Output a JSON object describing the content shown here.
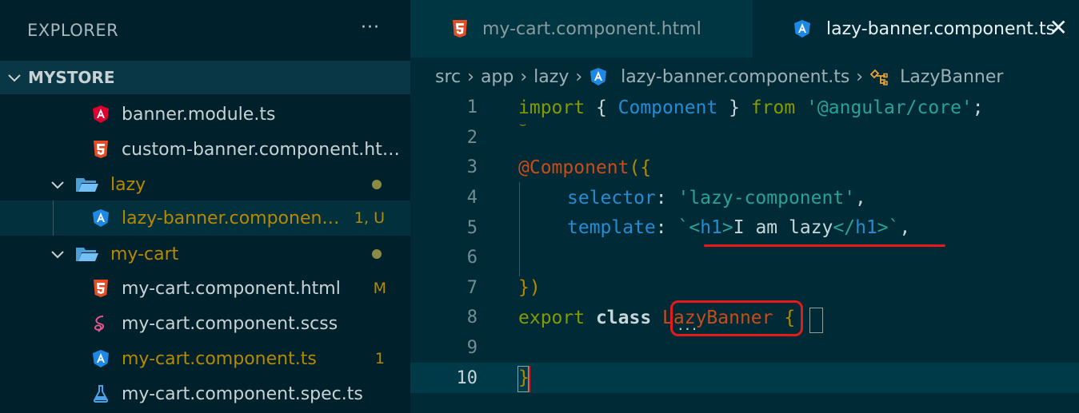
{
  "sidebar": {
    "title": "EXPLORER",
    "more": "···",
    "workspace": "MYSTORE",
    "items": [
      {
        "label": "banner.module.ts",
        "badge": ""
      },
      {
        "label": "custom-banner.component.ht…",
        "badge": ""
      },
      {
        "label": "lazy",
        "badge": ""
      },
      {
        "label": "lazy-banner.componen…",
        "badge": "1, U"
      },
      {
        "label": "my-cart",
        "badge": ""
      },
      {
        "label": "my-cart.component.html",
        "badge": "M"
      },
      {
        "label": "my-cart.component.scss",
        "badge": ""
      },
      {
        "label": "my-cart.component.ts",
        "badge": "1"
      },
      {
        "label": "my-cart.component.spec.ts",
        "badge": ""
      }
    ]
  },
  "tabs": [
    {
      "label": "my-cart.component.html"
    },
    {
      "label": "lazy-banner.component.ts",
      "close": "✕"
    }
  ],
  "breadcrumb": [
    "src",
    "app",
    "lazy",
    "lazy-banner.component.ts",
    "LazyBanner"
  ],
  "breadcrumb_sep": "›",
  "editor": {
    "line_numbers": [
      "1",
      "2",
      "3",
      "4",
      "5",
      "6",
      "7",
      "8",
      "9",
      "10"
    ],
    "code": {
      "l1": {
        "a": "import",
        "b": " { ",
        "c": "Component",
        "d": " } ",
        "e": "from",
        "f": " ",
        "g": "'@angular/core'",
        "h": ";"
      },
      "l3": {
        "a": "@",
        "b": "Component",
        "c": "({"
      },
      "l4": {
        "a": "selector",
        "b": ": ",
        "c": "'lazy-component'",
        "d": ","
      },
      "l5": {
        "a": "template",
        "b": ": ",
        "c": "`",
        "d": "<",
        "e": "h1",
        "f": ">",
        "g": "I am lazy",
        "h": "</",
        "i": "h1",
        "j": ">",
        "k": "`",
        "l": ","
      },
      "l7": {
        "a": "})"
      },
      "l8": {
        "a": "export",
        "b": " class ",
        "c": "LazyBanner",
        "d": " {"
      },
      "l10": {
        "a": "}"
      }
    }
  },
  "colors": {
    "accent_red": "#e31b1b",
    "angular_red": "#dd0031",
    "html_orange": "#e44d26",
    "folder_blue": "#5fb4f0",
    "modified_gold": "#b58900"
  }
}
